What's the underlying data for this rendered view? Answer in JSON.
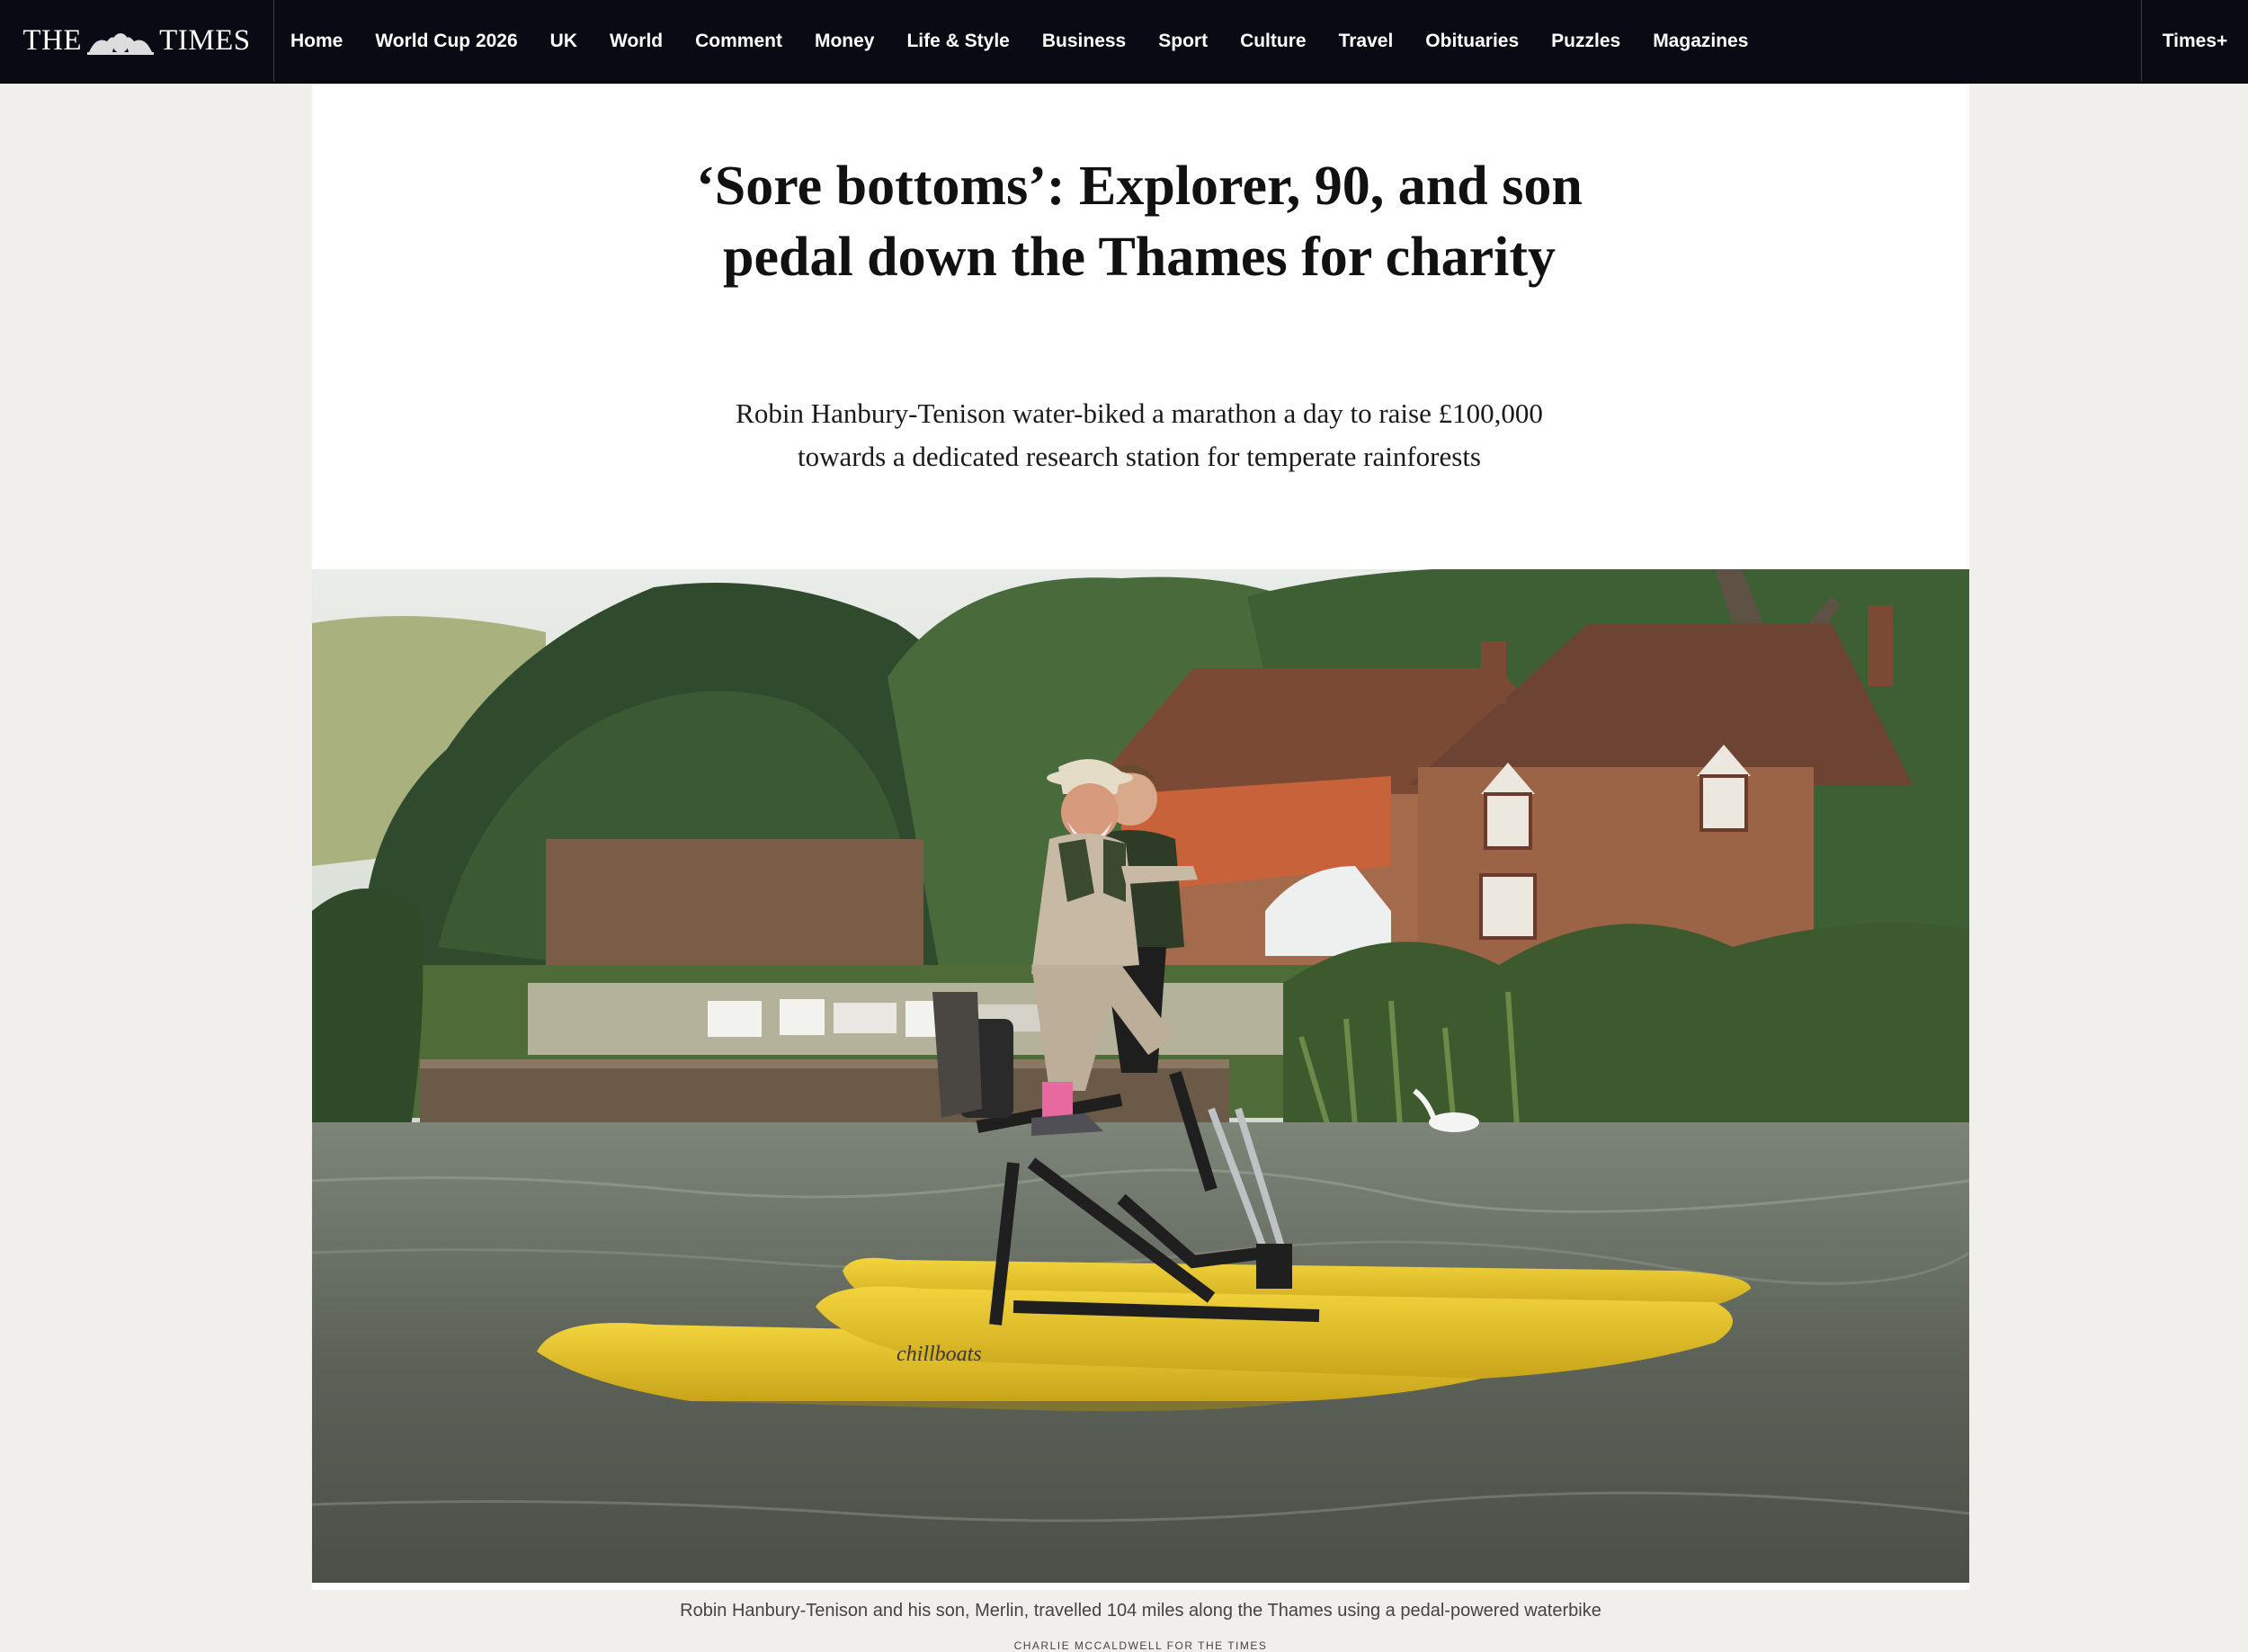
{
  "masthead": {
    "logo_left": "THE",
    "logo_right": "TIMES"
  },
  "nav": {
    "items": [
      "Home",
      "World Cup 2026",
      "UK",
      "World",
      "Comment",
      "Money",
      "Life & Style",
      "Business",
      "Sport",
      "Culture",
      "Travel",
      "Obituaries",
      "Puzzles",
      "Magazines"
    ],
    "plus_label": "Times+"
  },
  "article": {
    "headline": "‘Sore bottoms’: Explorer, 90, and son pedal down the Thames for charity",
    "standfirst": "Robin Hanbury-Tenison water-biked a marathon a day to raise £100,000 towards a dedicated research station for temperate rainforests",
    "image": {
      "boat_brand": "chillboats",
      "caption": "Robin Hanbury-Tenison and his son, Merlin, travelled 104 miles along the Thames using a pedal-powered waterbike",
      "credit": "CHARLIE MCCALDWELL FOR THE TIMES"
    }
  },
  "colors": {
    "nav_bg": "#0a0a14",
    "page_bg": "#f1efec",
    "pontoon": "#e8c62e"
  }
}
